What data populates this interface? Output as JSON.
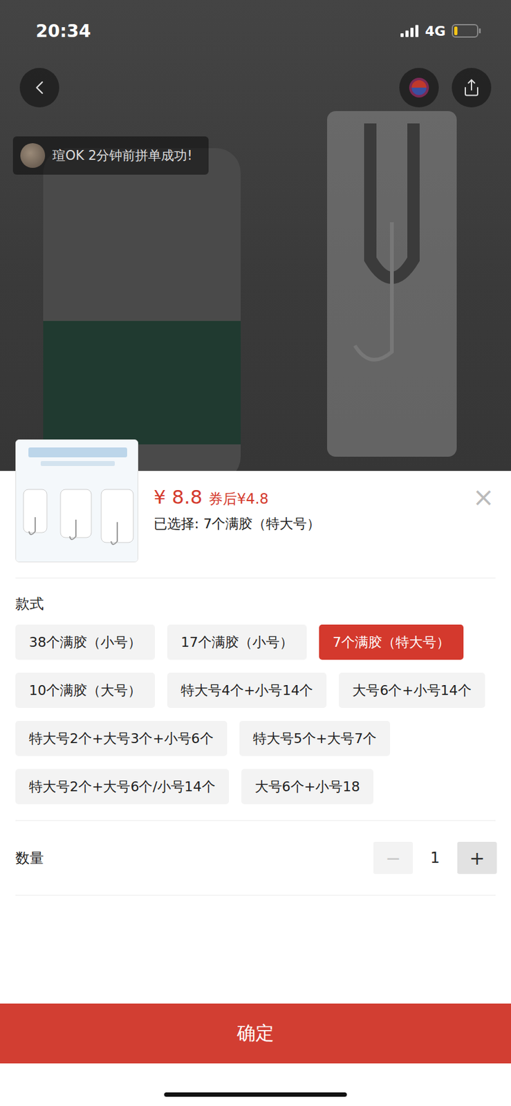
{
  "status_bar": {
    "time": "20:34",
    "network": "4G",
    "battery": {
      "level": 0.15,
      "color": "#f5c518"
    }
  },
  "toast": {
    "text": "瑄OK 2分钟前拼单成功!"
  },
  "sheet": {
    "price": "¥ 8.8",
    "coupon": "券后¥4.8",
    "selected_text": "已选择: 7个满胶（特大号）",
    "close": "×"
  },
  "specs": {
    "label": "款式",
    "options": [
      {
        "label": "38个满胶（小号）",
        "selected": false
      },
      {
        "label": "17个满胶（小号）",
        "selected": false
      },
      {
        "label": "7个满胶（特大号）",
        "selected": true
      },
      {
        "label": "10个满胶（大号）",
        "selected": false
      },
      {
        "label": "特大号4个+小号14个",
        "selected": false
      },
      {
        "label": "大号6个+小号14个",
        "selected": false
      },
      {
        "label": "特大号2个+大号3个+小号6个",
        "selected": false
      },
      {
        "label": "特大号5个+大号7个",
        "selected": false
      },
      {
        "label": "特大号2个+大号6个/小号14个",
        "selected": false
      },
      {
        "label": "大号6个+小号18",
        "selected": false
      }
    ]
  },
  "quantity": {
    "label": "数量",
    "value": "1",
    "minus": {
      "glyph": "−",
      "disabled": true
    },
    "plus": {
      "glyph": "+",
      "disabled": false
    }
  },
  "confirm": {
    "label": "确定"
  }
}
